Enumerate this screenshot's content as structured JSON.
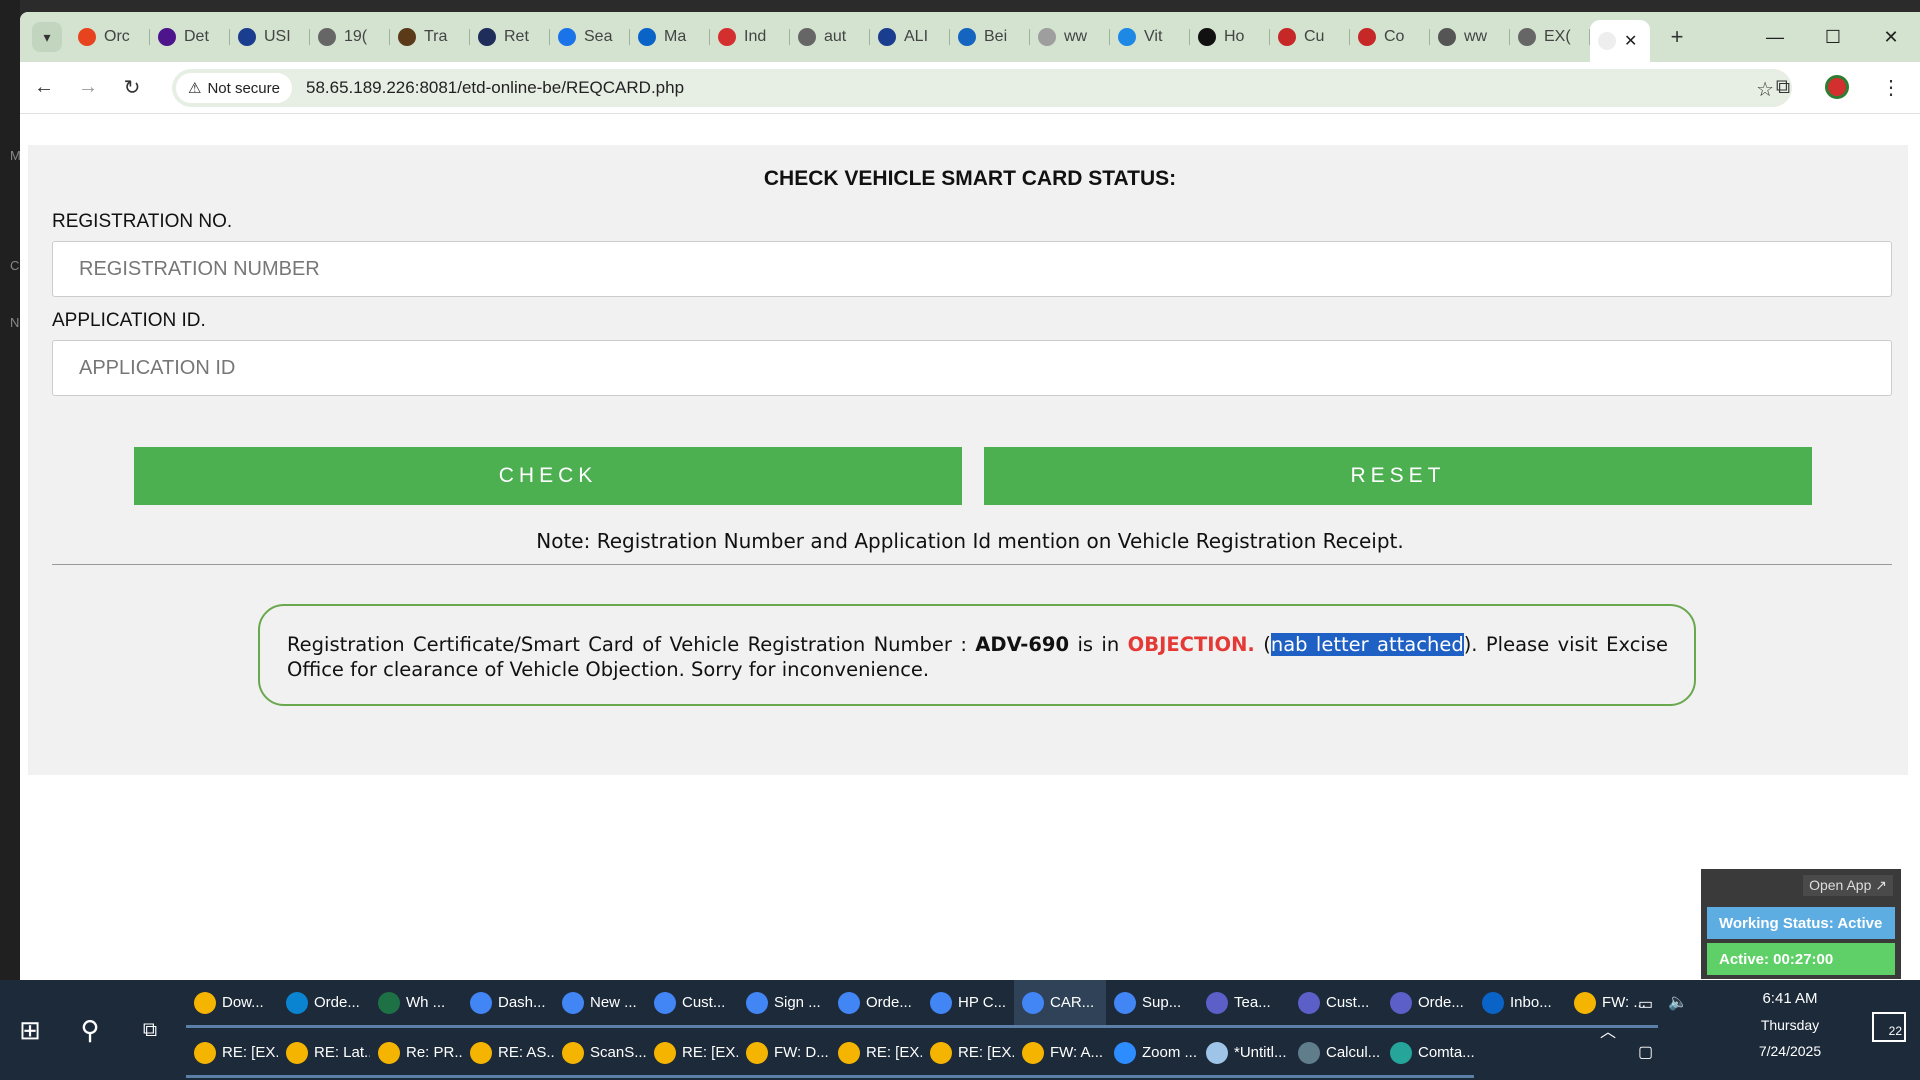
{
  "browser": {
    "tabs": [
      {
        "label": "Orc",
        "icon": "swirl-icon",
        "color": "#e8431f"
      },
      {
        "label": "Det",
        "icon": "fedex-icon",
        "color": "#4d148c"
      },
      {
        "label": "USI",
        "icon": "usps-icon",
        "color": "#1a3d8f"
      },
      {
        "label": "19(",
        "icon": "globe-icon",
        "color": "#666666"
      },
      {
        "label": "Tra",
        "icon": "ups-icon",
        "color": "#5b3a1a"
      },
      {
        "label": "Ret",
        "icon": "check-icon",
        "color": "#1f2d5a"
      },
      {
        "label": "Sea",
        "icon": "star-icon",
        "color": "#1a73e8"
      },
      {
        "label": "Ma",
        "icon": "outlook-icon",
        "color": "#0a64c8"
      },
      {
        "label": "Ind",
        "icon": "stripes-icon",
        "color": "#d32f2f"
      },
      {
        "label": "aut",
        "icon": "globe-icon",
        "color": "#666666"
      },
      {
        "label": "ALI",
        "icon": "seventeen-icon",
        "color": "#1a3d8f"
      },
      {
        "label": "Bei",
        "icon": "f-icon",
        "color": "#1565c0"
      },
      {
        "label": "ww",
        "icon": "loading-icon",
        "color": "#9e9e9e"
      },
      {
        "label": "Vit",
        "icon": "s-icon",
        "color": "#1e88e5"
      },
      {
        "label": "Ho",
        "icon": "x-icon",
        "color": "#111111"
      },
      {
        "label": "Cu",
        "icon": "chat-icon",
        "color": "#c62828"
      },
      {
        "label": "Co",
        "icon": "chat-icon",
        "color": "#c62828"
      },
      {
        "label": "ww",
        "icon": "web-icon",
        "color": "#555555"
      },
      {
        "label": "EX(",
        "icon": "globe-icon",
        "color": "#666666"
      }
    ],
    "new_tab": "+",
    "security_label": "Not secure",
    "url": "58.65.189.226:8081/etd-online-be/REQCARD.php"
  },
  "page": {
    "title": "CHECK VEHICLE SMART CARD STATUS:",
    "reg_label": "REGISTRATION NO.",
    "reg_placeholder": "REGISTRATION NUMBER",
    "app_label": "APPLICATION ID.",
    "app_placeholder": "APPLICATION ID",
    "check_button": "CHECK",
    "reset_button": "RESET",
    "note": "Note: Registration Number and Application Id mention on Vehicle Registration Receipt.",
    "result": {
      "part1": "Registration Certificate/Smart Card of Vehicle Registration Number :",
      "reg_number": "ADV-690",
      "part2": "is in",
      "status": "OBJECTION.",
      "open_paren": "(",
      "selected_text": "nab letter attached",
      "part3": "). Please visit Excise Office for clearance of Vehicle Objection. Sorry for inconvenience."
    }
  },
  "widget": {
    "open_app": "Open App ↗",
    "working_status": "Working Status: Active",
    "active_time": "Active: 00:27:00"
  },
  "taskbar": {
    "row1": [
      {
        "label": "Dow...",
        "color": "#f4b400"
      },
      {
        "label": "Orde...",
        "color": "#0a84d0"
      },
      {
        "label": "Wh ...",
        "color": "#1e7145"
      },
      {
        "label": "Dash...",
        "color": "#4285f4"
      },
      {
        "label": "New ...",
        "color": "#4285f4"
      },
      {
        "label": "Cust...",
        "color": "#4285f4"
      },
      {
        "label": "Sign ...",
        "color": "#4285f4"
      },
      {
        "label": "Orde...",
        "color": "#4285f4"
      },
      {
        "label": "HP C...",
        "color": "#4285f4"
      },
      {
        "label": "CAR...",
        "color": "#4285f4"
      },
      {
        "label": "Sup...",
        "color": "#4285f4"
      },
      {
        "label": "Tea...",
        "color": "#5b5fc7"
      },
      {
        "label": "Cust...",
        "color": "#5b5fc7"
      },
      {
        "label": "Orde...",
        "color": "#5b5fc7"
      },
      {
        "label": "Inbo...",
        "color": "#0a64c8"
      },
      {
        "label": "FW: ...",
        "color": "#f4b400"
      }
    ],
    "row2": [
      {
        "label": "RE: [EX...",
        "color": "#f4b400"
      },
      {
        "label": "RE: Lat...",
        "color": "#f4b400"
      },
      {
        "label": "Re: PR...",
        "color": "#f4b400"
      },
      {
        "label": "RE: AS...",
        "color": "#f4b400"
      },
      {
        "label": "ScanS...",
        "color": "#f4b400"
      },
      {
        "label": "RE: [EX...",
        "color": "#f4b400"
      },
      {
        "label": "FW: D...",
        "color": "#f4b400"
      },
      {
        "label": "RE: [EX...",
        "color": "#f4b400"
      },
      {
        "label": "RE: [EX...",
        "color": "#f4b400"
      },
      {
        "label": "FW: A...",
        "color": "#f4b400"
      },
      {
        "label": "Zoom ...",
        "color": "#2d8cff"
      },
      {
        "label": "*Untitl...",
        "color": "#9ec5e8"
      },
      {
        "label": "Calcul...",
        "color": "#607d8b"
      },
      {
        "label": "Comta...",
        "color": "#26a69a"
      }
    ],
    "time": "6:41 AM",
    "day": "Thursday",
    "date": "7/24/2025",
    "notifications": "22"
  }
}
